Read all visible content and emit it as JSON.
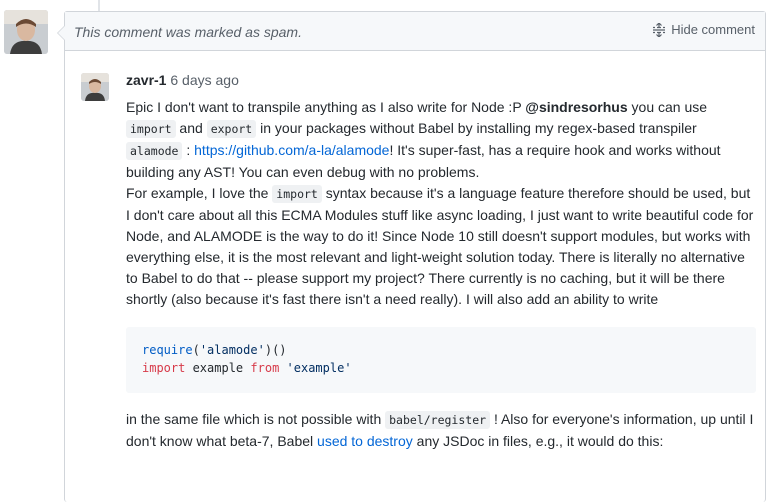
{
  "spam_notice": "This comment was marked as spam.",
  "hide_comment_label": "Hide comment",
  "comment": {
    "author": "zavr-1",
    "time": "6 days ago",
    "p1": {
      "a": "Epic I don't want to transpile anything as I also write for Node :P ",
      "mention": "@sindresorhus",
      "b": " you can use ",
      "code_import": "import",
      "c": " and ",
      "code_export": "export",
      "d": " in your packages without Babel by installing my regex-based transpiler ",
      "code_alamode": "alamode",
      "e": " : ",
      "link": "https://github.com/a-la/alamode",
      "f": "! It's super-fast, has a require hook and works without building any AST! You can even debug with no problems."
    },
    "p2": {
      "a": "For example, I love the ",
      "code_import": "import",
      "b": " syntax because it's a language feature therefore should be used, but I don't care about all this ECMA Modules stuff like async loading, I just want to write beautiful code for Node, and ALAMODE is the way to do it! Since Node 10 still doesn't support modules, but works with everything else, it is the most relevant and light-weight solution today. There is literally no alternative to Babel to do that -- please support my project? There currently is no caching, but it will be there shortly (also because it's fast there isn't a need really). I will also add an ability to write"
    },
    "code_block": {
      "l1_fn": "require",
      "l1_rest": "(",
      "l1_str": "'alamode'",
      "l1_end": ")()",
      "l2_kw1": "import",
      "l2_mid": " example ",
      "l2_kw2": "from",
      "l2_sp": " ",
      "l2_str": "'example'"
    },
    "p3": {
      "a": "in the same file which is not possible with ",
      "code_babel": "babel/register",
      "b": " ! Also for everyone's information, up until I don't know what beta-7, Babel ",
      "link": "used to destroy",
      "c": " any JSDoc in files, e.g., it would do this:"
    }
  }
}
